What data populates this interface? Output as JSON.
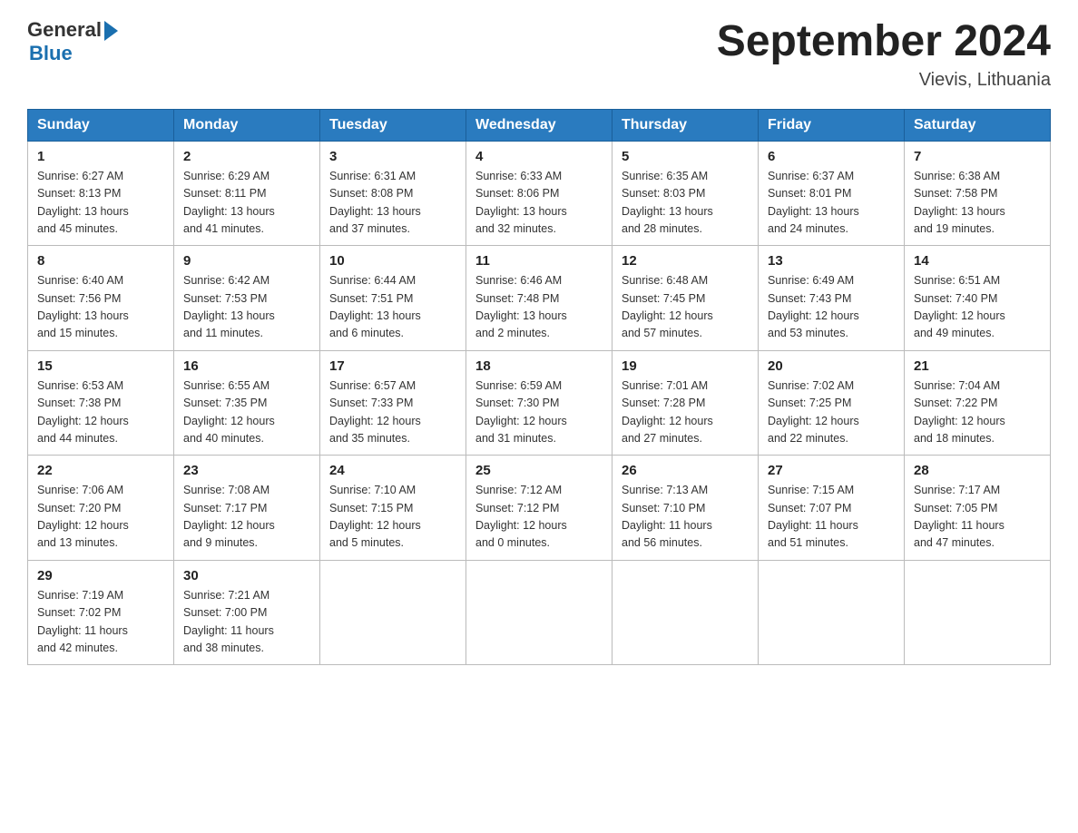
{
  "header": {
    "logo": {
      "general": "General",
      "blue": "Blue"
    },
    "title": "September 2024",
    "location": "Vievis, Lithuania"
  },
  "weekdays": [
    "Sunday",
    "Monday",
    "Tuesday",
    "Wednesday",
    "Thursday",
    "Friday",
    "Saturday"
  ],
  "weeks": [
    [
      {
        "day": "1",
        "sunrise": "6:27 AM",
        "sunset": "8:13 PM",
        "daylight": "13 hours and 45 minutes."
      },
      {
        "day": "2",
        "sunrise": "6:29 AM",
        "sunset": "8:11 PM",
        "daylight": "13 hours and 41 minutes."
      },
      {
        "day": "3",
        "sunrise": "6:31 AM",
        "sunset": "8:08 PM",
        "daylight": "13 hours and 37 minutes."
      },
      {
        "day": "4",
        "sunrise": "6:33 AM",
        "sunset": "8:06 PM",
        "daylight": "13 hours and 32 minutes."
      },
      {
        "day": "5",
        "sunrise": "6:35 AM",
        "sunset": "8:03 PM",
        "daylight": "13 hours and 28 minutes."
      },
      {
        "day": "6",
        "sunrise": "6:37 AM",
        "sunset": "8:01 PM",
        "daylight": "13 hours and 24 minutes."
      },
      {
        "day": "7",
        "sunrise": "6:38 AM",
        "sunset": "7:58 PM",
        "daylight": "13 hours and 19 minutes."
      }
    ],
    [
      {
        "day": "8",
        "sunrise": "6:40 AM",
        "sunset": "7:56 PM",
        "daylight": "13 hours and 15 minutes."
      },
      {
        "day": "9",
        "sunrise": "6:42 AM",
        "sunset": "7:53 PM",
        "daylight": "13 hours and 11 minutes."
      },
      {
        "day": "10",
        "sunrise": "6:44 AM",
        "sunset": "7:51 PM",
        "daylight": "13 hours and 6 minutes."
      },
      {
        "day": "11",
        "sunrise": "6:46 AM",
        "sunset": "7:48 PM",
        "daylight": "13 hours and 2 minutes."
      },
      {
        "day": "12",
        "sunrise": "6:48 AM",
        "sunset": "7:45 PM",
        "daylight": "12 hours and 57 minutes."
      },
      {
        "day": "13",
        "sunrise": "6:49 AM",
        "sunset": "7:43 PM",
        "daylight": "12 hours and 53 minutes."
      },
      {
        "day": "14",
        "sunrise": "6:51 AM",
        "sunset": "7:40 PM",
        "daylight": "12 hours and 49 minutes."
      }
    ],
    [
      {
        "day": "15",
        "sunrise": "6:53 AM",
        "sunset": "7:38 PM",
        "daylight": "12 hours and 44 minutes."
      },
      {
        "day": "16",
        "sunrise": "6:55 AM",
        "sunset": "7:35 PM",
        "daylight": "12 hours and 40 minutes."
      },
      {
        "day": "17",
        "sunrise": "6:57 AM",
        "sunset": "7:33 PM",
        "daylight": "12 hours and 35 minutes."
      },
      {
        "day": "18",
        "sunrise": "6:59 AM",
        "sunset": "7:30 PM",
        "daylight": "12 hours and 31 minutes."
      },
      {
        "day": "19",
        "sunrise": "7:01 AM",
        "sunset": "7:28 PM",
        "daylight": "12 hours and 27 minutes."
      },
      {
        "day": "20",
        "sunrise": "7:02 AM",
        "sunset": "7:25 PM",
        "daylight": "12 hours and 22 minutes."
      },
      {
        "day": "21",
        "sunrise": "7:04 AM",
        "sunset": "7:22 PM",
        "daylight": "12 hours and 18 minutes."
      }
    ],
    [
      {
        "day": "22",
        "sunrise": "7:06 AM",
        "sunset": "7:20 PM",
        "daylight": "12 hours and 13 minutes."
      },
      {
        "day": "23",
        "sunrise": "7:08 AM",
        "sunset": "7:17 PM",
        "daylight": "12 hours and 9 minutes."
      },
      {
        "day": "24",
        "sunrise": "7:10 AM",
        "sunset": "7:15 PM",
        "daylight": "12 hours and 5 minutes."
      },
      {
        "day": "25",
        "sunrise": "7:12 AM",
        "sunset": "7:12 PM",
        "daylight": "12 hours and 0 minutes."
      },
      {
        "day": "26",
        "sunrise": "7:13 AM",
        "sunset": "7:10 PM",
        "daylight": "11 hours and 56 minutes."
      },
      {
        "day": "27",
        "sunrise": "7:15 AM",
        "sunset": "7:07 PM",
        "daylight": "11 hours and 51 minutes."
      },
      {
        "day": "28",
        "sunrise": "7:17 AM",
        "sunset": "7:05 PM",
        "daylight": "11 hours and 47 minutes."
      }
    ],
    [
      {
        "day": "29",
        "sunrise": "7:19 AM",
        "sunset": "7:02 PM",
        "daylight": "11 hours and 42 minutes."
      },
      {
        "day": "30",
        "sunrise": "7:21 AM",
        "sunset": "7:00 PM",
        "daylight": "11 hours and 38 minutes."
      },
      null,
      null,
      null,
      null,
      null
    ]
  ],
  "labels": {
    "sunrise": "Sunrise:",
    "sunset": "Sunset:",
    "daylight": "Daylight:"
  }
}
